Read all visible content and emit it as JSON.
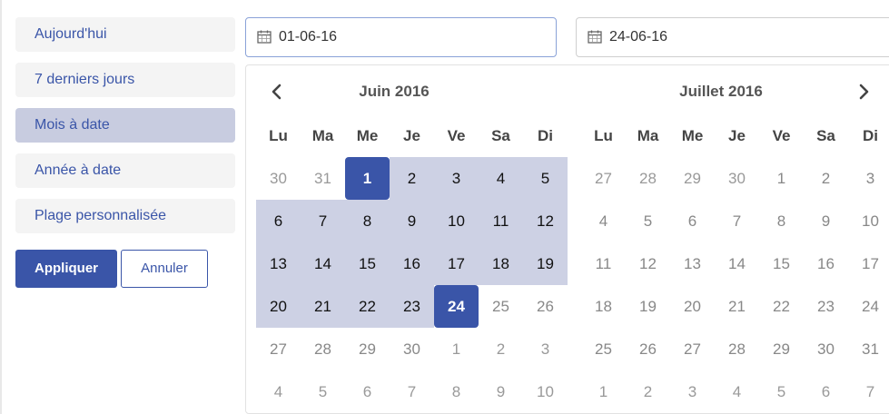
{
  "ranges": [
    {
      "label": "Aujourd'hui",
      "active": false
    },
    {
      "label": "7 derniers jours",
      "active": false
    },
    {
      "label": "Mois à date",
      "active": true
    },
    {
      "label": "Année à date",
      "active": false
    },
    {
      "label": "Plage personnalisée",
      "active": false
    }
  ],
  "buttons": {
    "apply": "Appliquer",
    "cancel": "Annuler"
  },
  "inputs": {
    "start": "01-06-16",
    "end": "24-06-16"
  },
  "icons": {
    "calendar": "calendar-icon",
    "prev": "chevron-left-icon",
    "next": "chevron-right-icon"
  },
  "colors": {
    "accent": "#3a55a8",
    "range": "#cdd1e4",
    "active_item": "#c8cce0"
  },
  "weekdays": [
    "Lu",
    "Ma",
    "Me",
    "Je",
    "Ve",
    "Sa",
    "Di"
  ],
  "calendars": [
    {
      "title": "Juin 2016",
      "weeks": [
        [
          {
            "d": "30",
            "s": "off"
          },
          {
            "d": "31",
            "s": "off"
          },
          {
            "d": "1",
            "s": "sel"
          },
          {
            "d": "2",
            "s": "inrange"
          },
          {
            "d": "3",
            "s": "inrange"
          },
          {
            "d": "4",
            "s": "inrange"
          },
          {
            "d": "5",
            "s": "inrange"
          }
        ],
        [
          {
            "d": "6",
            "s": "inrange"
          },
          {
            "d": "7",
            "s": "inrange"
          },
          {
            "d": "8",
            "s": "inrange"
          },
          {
            "d": "9",
            "s": "inrange"
          },
          {
            "d": "10",
            "s": "inrange"
          },
          {
            "d": "11",
            "s": "inrange"
          },
          {
            "d": "12",
            "s": "inrange"
          }
        ],
        [
          {
            "d": "13",
            "s": "inrange"
          },
          {
            "d": "14",
            "s": "inrange"
          },
          {
            "d": "15",
            "s": "inrange"
          },
          {
            "d": "16",
            "s": "inrange"
          },
          {
            "d": "17",
            "s": "inrange"
          },
          {
            "d": "18",
            "s": "inrange"
          },
          {
            "d": "19",
            "s": "inrange"
          }
        ],
        [
          {
            "d": "20",
            "s": "inrange"
          },
          {
            "d": "21",
            "s": "inrange"
          },
          {
            "d": "22",
            "s": "inrange"
          },
          {
            "d": "23",
            "s": "inrange"
          },
          {
            "d": "24",
            "s": "sel"
          },
          {
            "d": "25",
            "s": "muted"
          },
          {
            "d": "26",
            "s": "muted"
          }
        ],
        [
          {
            "d": "27",
            "s": "muted"
          },
          {
            "d": "28",
            "s": "muted"
          },
          {
            "d": "29",
            "s": "muted"
          },
          {
            "d": "30",
            "s": "muted"
          },
          {
            "d": "1",
            "s": "off"
          },
          {
            "d": "2",
            "s": "off"
          },
          {
            "d": "3",
            "s": "off"
          }
        ],
        [
          {
            "d": "4",
            "s": "off"
          },
          {
            "d": "5",
            "s": "off"
          },
          {
            "d": "6",
            "s": "off"
          },
          {
            "d": "7",
            "s": "off"
          },
          {
            "d": "8",
            "s": "off"
          },
          {
            "d": "9",
            "s": "off"
          },
          {
            "d": "10",
            "s": "off"
          }
        ]
      ]
    },
    {
      "title": "Juillet 2016",
      "weeks": [
        [
          {
            "d": "27",
            "s": "off"
          },
          {
            "d": "28",
            "s": "off"
          },
          {
            "d": "29",
            "s": "off"
          },
          {
            "d": "30",
            "s": "off"
          },
          {
            "d": "1",
            "s": "muted"
          },
          {
            "d": "2",
            "s": "muted"
          },
          {
            "d": "3",
            "s": "muted"
          }
        ],
        [
          {
            "d": "4",
            "s": "muted"
          },
          {
            "d": "5",
            "s": "muted"
          },
          {
            "d": "6",
            "s": "muted"
          },
          {
            "d": "7",
            "s": "muted"
          },
          {
            "d": "8",
            "s": "muted"
          },
          {
            "d": "9",
            "s": "muted"
          },
          {
            "d": "10",
            "s": "muted"
          }
        ],
        [
          {
            "d": "11",
            "s": "muted"
          },
          {
            "d": "12",
            "s": "muted"
          },
          {
            "d": "13",
            "s": "muted"
          },
          {
            "d": "14",
            "s": "muted"
          },
          {
            "d": "15",
            "s": "muted"
          },
          {
            "d": "16",
            "s": "muted"
          },
          {
            "d": "17",
            "s": "muted"
          }
        ],
        [
          {
            "d": "18",
            "s": "muted"
          },
          {
            "d": "19",
            "s": "muted"
          },
          {
            "d": "20",
            "s": "muted"
          },
          {
            "d": "21",
            "s": "muted"
          },
          {
            "d": "22",
            "s": "muted"
          },
          {
            "d": "23",
            "s": "muted"
          },
          {
            "d": "24",
            "s": "muted"
          }
        ],
        [
          {
            "d": "25",
            "s": "muted"
          },
          {
            "d": "26",
            "s": "muted"
          },
          {
            "d": "27",
            "s": "muted"
          },
          {
            "d": "28",
            "s": "muted"
          },
          {
            "d": "29",
            "s": "muted"
          },
          {
            "d": "30",
            "s": "muted"
          },
          {
            "d": "31",
            "s": "muted"
          }
        ],
        [
          {
            "d": "1",
            "s": "off"
          },
          {
            "d": "2",
            "s": "off"
          },
          {
            "d": "3",
            "s": "off"
          },
          {
            "d": "4",
            "s": "off"
          },
          {
            "d": "5",
            "s": "off"
          },
          {
            "d": "6",
            "s": "off"
          },
          {
            "d": "7",
            "s": "off"
          }
        ]
      ]
    }
  ]
}
